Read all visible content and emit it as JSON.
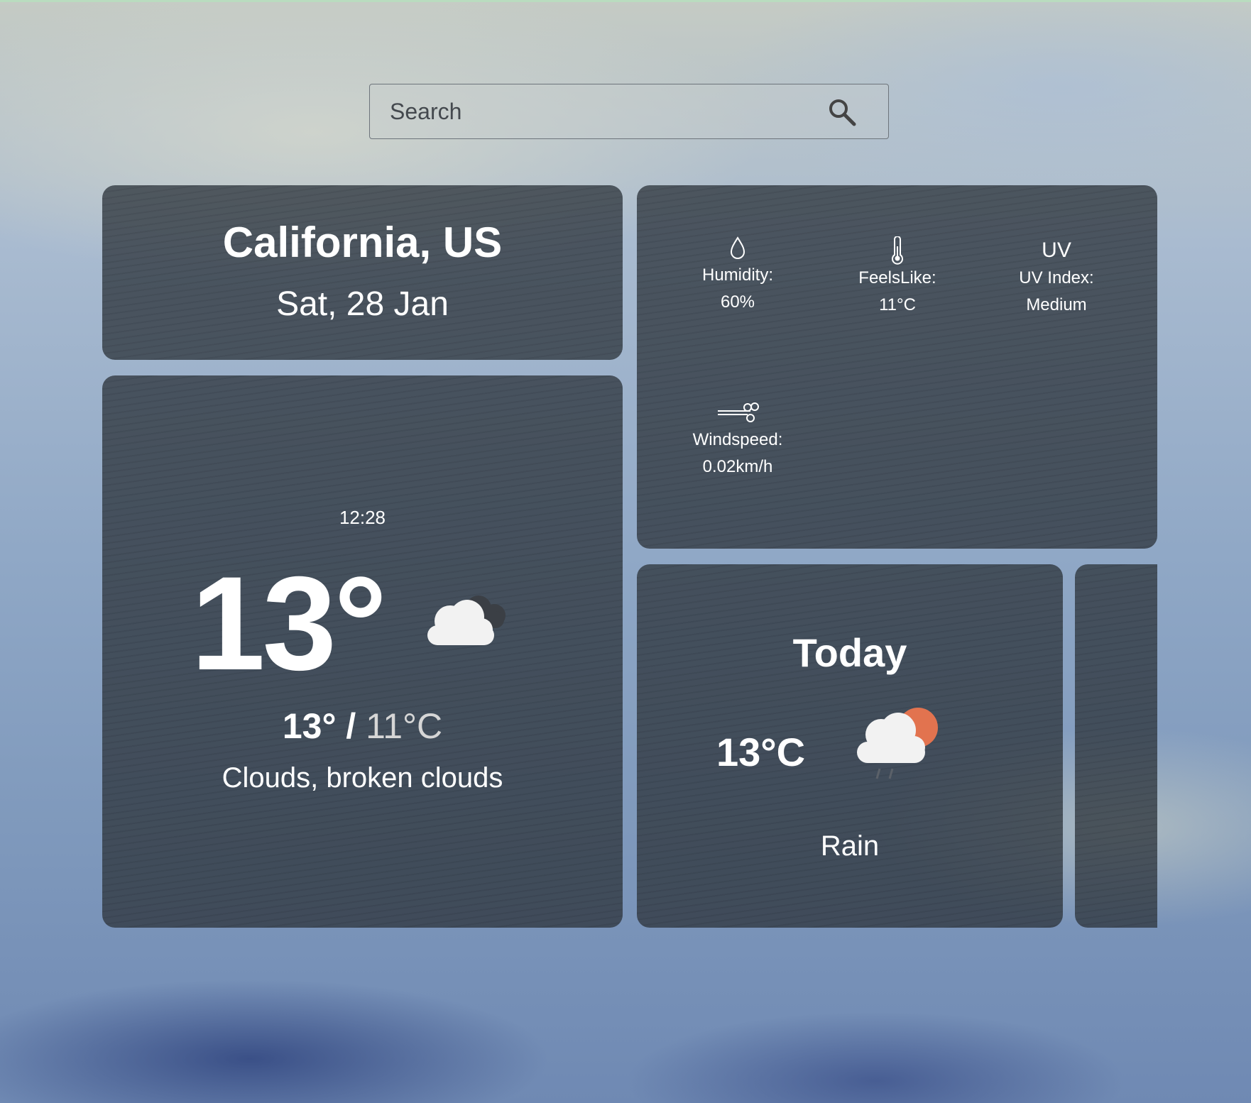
{
  "search": {
    "placeholder": "Search",
    "icon": "search-icon"
  },
  "location": {
    "title": "California, US",
    "date": "Sat, 28 Jan"
  },
  "current": {
    "time": "12:28",
    "temp": "13°",
    "high": "13°",
    "separator": " / ",
    "low": "11°C",
    "description": "Clouds, broken clouds",
    "icon": "broken-clouds-icon"
  },
  "details": {
    "humidity": {
      "label": "Humidity:",
      "value": "60%",
      "icon": "droplet-icon"
    },
    "feels_like": {
      "label": "FeelsLike:",
      "value": "11°C",
      "icon": "thermometer-icon"
    },
    "uv": {
      "label": "UV Index:",
      "value": "Medium",
      "icon": "uv-icon",
      "icon_text": "UV"
    },
    "wind": {
      "label": "Windspeed:",
      "value": "0.02km/h",
      "icon": "wind-icon"
    }
  },
  "forecast": [
    {
      "day": "Today",
      "temp": "13°C",
      "description": "Rain",
      "icon": "rain-cloud-sun-icon",
      "sun_color": "#e2734f"
    }
  ],
  "colors": {
    "card_bg": "#30373f",
    "text": "#ffffff",
    "low_temp": "#d6d6d6"
  }
}
